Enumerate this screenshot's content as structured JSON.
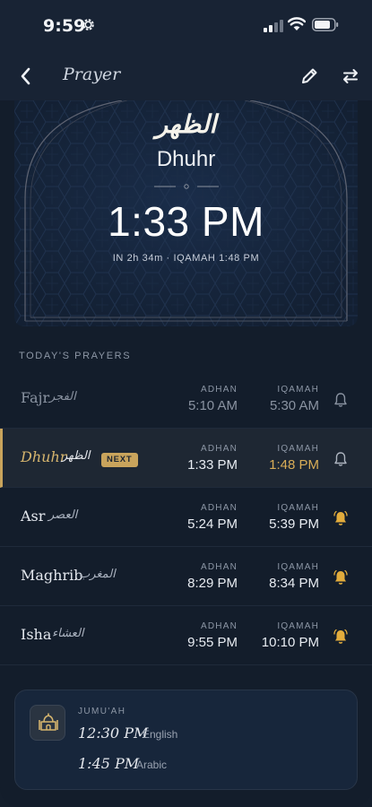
{
  "status_bar": {
    "time": "9:59"
  },
  "nav": {
    "title": "Prayer"
  },
  "hero": {
    "arabic_name": "الظهر",
    "english_name": "Dhuhr",
    "time": "1:33 PM",
    "subtitle": "IN 2h 34m · IQAMAH 1:48 PM"
  },
  "section": {
    "label": "TODAY'S PRAYERS"
  },
  "prayers": [
    {
      "name": "Fajr",
      "arabic": "الفجر",
      "adhan_label": "ADHAN",
      "adhan": "5:10 AM",
      "iqamah_label": "IQAMAH",
      "iqamah": "5:30 AM",
      "state": "past",
      "alert": "off"
    },
    {
      "name": "Dhuhr",
      "arabic": "الظهر",
      "badge": "NEXT",
      "adhan_label": "ADHAN",
      "adhan": "1:33 PM",
      "iqamah_label": "IQAMAH",
      "iqamah": "1:48 PM",
      "state": "next",
      "alert": "off"
    },
    {
      "name": "Asr",
      "arabic": "العصر",
      "adhan_label": "ADHAN",
      "adhan": "5:24 PM",
      "iqamah_label": "IQAMAH",
      "iqamah": "5:39 PM",
      "state": "upcoming",
      "alert": "on"
    },
    {
      "name": "Maghrib",
      "arabic": "المغرب",
      "adhan_label": "ADHAN",
      "adhan": "8:29 PM",
      "iqamah_label": "IQAMAH",
      "iqamah": "8:34 PM",
      "state": "upcoming",
      "alert": "on"
    },
    {
      "name": "Isha",
      "arabic": "العشاء",
      "adhan_label": "ADHAN",
      "adhan": "9:55 PM",
      "iqamah_label": "IQAMAH",
      "iqamah": "10:10 PM",
      "state": "upcoming",
      "alert": "on"
    }
  ],
  "jumuah": {
    "label": "JUMU'AH",
    "sessions": [
      {
        "time": "12:30 PM",
        "language": "English"
      },
      {
        "time": "1:45 PM",
        "language": "Arabic"
      }
    ]
  },
  "colors": {
    "accent_gold": "#c9a45c",
    "background": "#131d2b",
    "bell_on": "#e2ac3c",
    "bell_off": "#8a93a1"
  },
  "icons": {
    "status": [
      "gear-icon",
      "signal-icon",
      "wifi-icon",
      "battery-icon"
    ],
    "nav": [
      "back-chevron-icon",
      "pencil-icon",
      "swap-arrows-icon"
    ],
    "jumuah": "mosque-icon",
    "alerts": "bell-icon"
  }
}
